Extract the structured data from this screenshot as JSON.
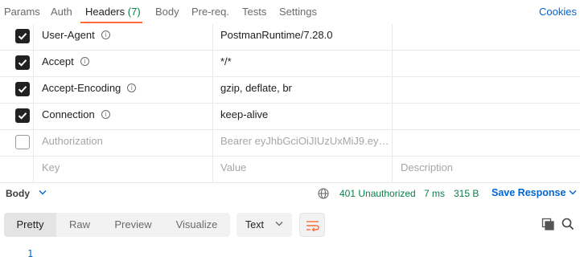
{
  "tabs": {
    "params": "Params",
    "auth": "Auth",
    "headers": "Headers",
    "headers_count": "(7)",
    "body": "Body",
    "prereq": "Pre-req.",
    "tests": "Tests",
    "settings": "Settings",
    "cookies": "Cookies"
  },
  "headers": [
    {
      "key": "User-Agent",
      "value": "PostmanRuntime/7.28.0",
      "enabled": true
    },
    {
      "key": "Accept",
      "value": "*/*",
      "enabled": true
    },
    {
      "key": "Accept-Encoding",
      "value": "gzip, deflate, br",
      "enabled": true
    },
    {
      "key": "Connection",
      "value": "keep-alive",
      "enabled": true
    },
    {
      "key": "Authorization",
      "value": "Bearer eyJhbGciOiJIUzUxMiJ9.eyJ...",
      "enabled": false
    }
  ],
  "new_row": {
    "key_placeholder": "Key",
    "value_placeholder": "Value",
    "description_placeholder": "Description"
  },
  "response": {
    "body_label": "Body",
    "status": "401 Unauthorized",
    "time": "7 ms",
    "size": "315 B",
    "save_label": "Save Response"
  },
  "format": {
    "options": [
      "Pretty",
      "Raw",
      "Preview",
      "Visualize"
    ],
    "selected": "Pretty",
    "language": "Text"
  },
  "editor": {
    "line_number": "1"
  },
  "colors": {
    "accent": "#ff6c37",
    "link": "#0265d2",
    "success": "#0c7d4a"
  }
}
